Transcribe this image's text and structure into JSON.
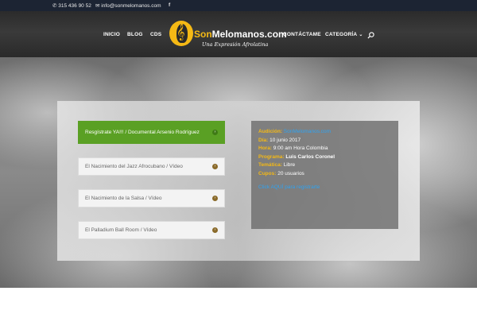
{
  "topbar": {
    "phone": "315 436 90 52",
    "email": "info@sonmelomanos.com",
    "social_icon": "facebook-icon"
  },
  "header": {
    "nav_left": [
      "INICIO",
      "BLOG",
      "CDS"
    ],
    "nav_right": [
      "CONTÁCTAME",
      "CATEGORÍA"
    ],
    "brand": {
      "part1": "Son",
      "part2": "Melomanos.com",
      "tagline": "Una Expresión Afrolatina"
    },
    "search_icon": "search-icon"
  },
  "accordion": {
    "items": [
      {
        "label": "Resgístrate YA!!! / Documental Arsenio Rodríguez",
        "active": true
      },
      {
        "label": "El Nacimiento del Jazz Afrocubano / Vídeo",
        "active": false
      },
      {
        "label": "El Nacimiento de la Salsa / Vídeo",
        "active": false
      },
      {
        "label": "El Palladium Ball Room / Vídeo",
        "active": false
      }
    ]
  },
  "info": {
    "audicion_key": "Audición:",
    "audicion_val": "SonMelomanos.com",
    "dia_key": "Día:",
    "dia_val": "10 junio 2017",
    "hora_key": "Hora:",
    "hora_val": "9:00 am Hora Colombia",
    "programa_key": "Programa:",
    "programa_val": "Luis Carlos Coronel",
    "tematica_key": "Temática:",
    "tematica_val": "Libre",
    "cupos_key": "Cupos:",
    "cupos_val": "20 usuarios",
    "cta": "Click AQUÍ para registrarte"
  },
  "colors": {
    "accent": "#f5b915",
    "active_green": "#5aa024",
    "link_blue": "#2ea3f2",
    "topbar": "#1c2433"
  }
}
